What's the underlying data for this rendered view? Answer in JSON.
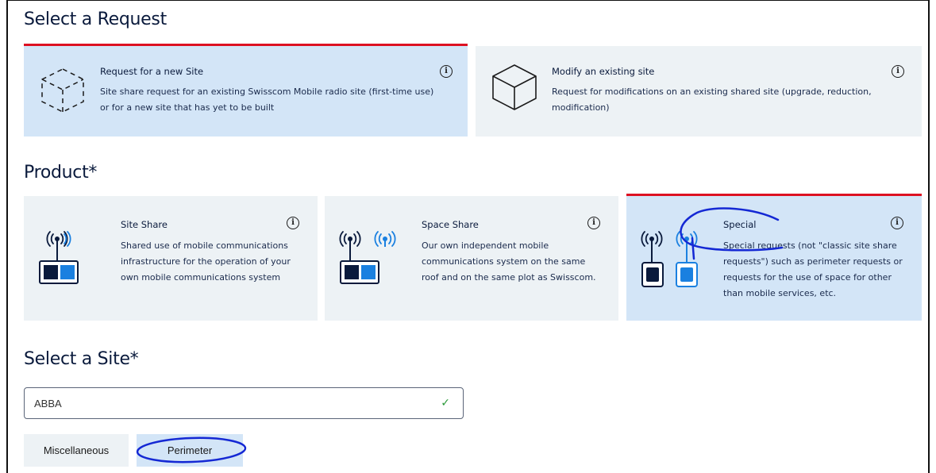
{
  "sections": {
    "request_title": "Select a Request",
    "product_title": "Product*",
    "site_title": "Select a Site*"
  },
  "request_cards": [
    {
      "title": "Request for a new Site",
      "description_lines": [
        "Site share request for an existing Swisscom Mobile radio site (first-time use)",
        "or for a new site that has yet to be built"
      ],
      "icon": "dashed-cube-icon",
      "selected": true
    },
    {
      "title": "Modify an existing site",
      "description_lines": [
        "Request for modifications on an existing shared site (upgrade, reduction,",
        "modification)"
      ],
      "icon": "cube-icon",
      "selected": false
    }
  ],
  "product_cards": [
    {
      "title": "Site Share",
      "description_lines": [
        "Shared use of mobile communications",
        "infrastructure for the operation of your",
        "own mobile communications system"
      ],
      "icon": "antenna-single-icon",
      "selected": false
    },
    {
      "title": "Space Share",
      "description_lines": [
        "Our own independent mobile",
        "communications system on the same",
        "roof and on the same plot as Swisscom."
      ],
      "icon": "antenna-double-icon",
      "selected": false
    },
    {
      "title": "Special",
      "description_lines": [
        "Special requests (not \"classic site share",
        "requests\") such as perimeter requests or",
        "requests for the use of space for other",
        "than mobile services, etc."
      ],
      "icon": "antenna-special-icon",
      "selected": true
    }
  ],
  "info_glyph": "i",
  "site_input": {
    "value": "ABBA",
    "status_icon": "checkmark-icon",
    "check_glyph": "✓"
  },
  "chips": [
    {
      "label": "Miscellaneous",
      "active": false
    },
    {
      "label": "Perimeter",
      "active": true
    }
  ],
  "colors": {
    "accent_red": "#dd1122",
    "selected_bg": "#d3e5f7",
    "card_bg": "#edf2f5",
    "navy": "#0a1a3c",
    "blue": "#1a80e0",
    "annotation_ink": "#1428d4"
  }
}
